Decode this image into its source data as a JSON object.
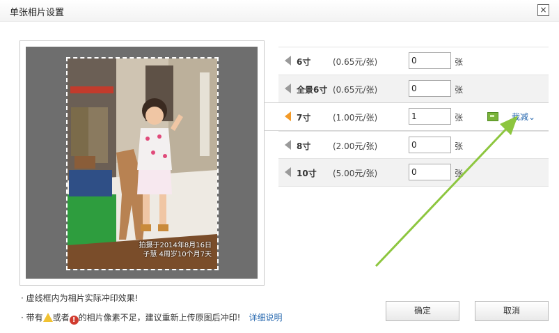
{
  "window": {
    "title": "单张相片设置",
    "close_label": "×"
  },
  "preview": {
    "stamp_line1": "拍摄于2014年8月16日",
    "stamp_line2": "子慧 4周岁10个月7天"
  },
  "sizes": [
    {
      "label": "6寸",
      "price": "(0.65元/张)",
      "quantity": "0",
      "unit": "张",
      "selected": false
    },
    {
      "label": "全景6寸",
      "price": "(0.65元/张)",
      "quantity": "0",
      "unit": "张",
      "selected": false
    },
    {
      "label": "7寸",
      "price": "(1.00元/张)",
      "quantity": "1",
      "unit": "张",
      "selected": true
    },
    {
      "label": "8寸",
      "price": "(2.00元/张)",
      "quantity": "0",
      "unit": "张",
      "selected": false
    },
    {
      "label": "10寸",
      "price": "(5.00元/张)",
      "quantity": "0",
      "unit": "张",
      "selected": false
    }
  ],
  "crop": {
    "label": "裁减",
    "chevron": "⌄"
  },
  "notes": {
    "note1": "虚线框内为相片实际冲印效果!",
    "note2_prefix": "带有",
    "note2_middle": "或者",
    "note2_suffix": "的相片像素不足，建议重新上传原图后冲印!",
    "detail_link": "详细说明"
  },
  "buttons": {
    "ok": "确定",
    "cancel": "取消"
  },
  "colors": {
    "accent_arrow": "#f39a28",
    "link": "#2a6ab0",
    "annotation_arrow": "#8dc63f"
  }
}
